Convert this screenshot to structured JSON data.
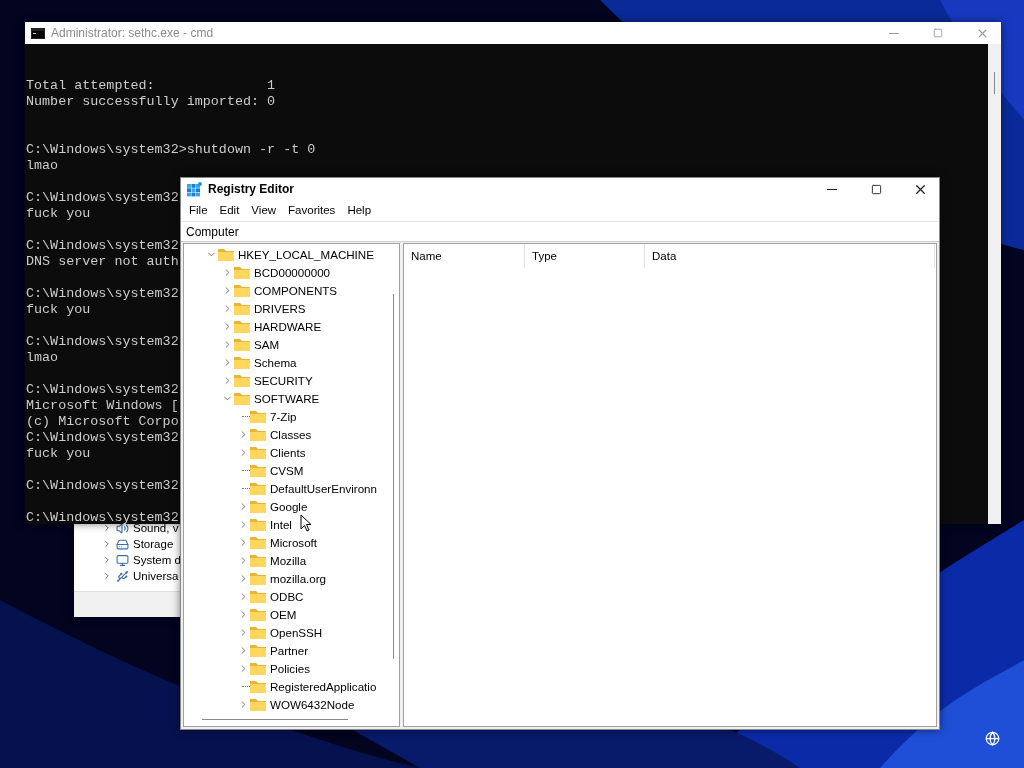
{
  "device_manager": {
    "items": [
      {
        "kind": "sound",
        "label": "Sound, v"
      },
      {
        "kind": "storage",
        "label": "Storage"
      },
      {
        "kind": "system",
        "label": "System d"
      },
      {
        "kind": "usb",
        "label": "Universa"
      }
    ]
  },
  "cmd": {
    "title": "Administrator: sethc.exe - cmd",
    "blocks": [
      [
        "Total attempted:              1",
        "Number successfully imported: 0"
      ],
      [
        "C:\\Windows\\system32>shutdown -r -t 0",
        "lmao"
      ],
      [
        "C:\\Windows\\system32",
        "fuck you"
      ],
      [
        "C:\\Windows\\system32",
        "DNS server not auth"
      ],
      [
        "C:\\Windows\\system32",
        "fuck you"
      ],
      [
        "C:\\Windows\\system32",
        "lmao"
      ],
      [
        "C:\\Windows\\system32",
        "Microsoft Windows [",
        "(c) Microsoft Corpo",
        "C:\\Windows\\system32",
        "fuck you"
      ],
      [
        "C:\\Windows\\system32"
      ],
      [
        "C:\\Windows\\system32"
      ]
    ]
  },
  "regedit": {
    "title": "Registry Editor",
    "menu": [
      "File",
      "Edit",
      "View",
      "Favorites",
      "Help"
    ],
    "address": "Computer",
    "tree": [
      {
        "label": "HKEY_LOCAL_MACHINE",
        "expanded": true,
        "children": [
          {
            "label": "BCD00000000",
            "expanded": false
          },
          {
            "label": "COMPONENTS",
            "expanded": false
          },
          {
            "label": "DRIVERS",
            "expanded": false
          },
          {
            "label": "HARDWARE",
            "expanded": false
          },
          {
            "label": "SAM",
            "expanded": false
          },
          {
            "label": "Schema",
            "expanded": false
          },
          {
            "label": "SECURITY",
            "expanded": false
          },
          {
            "label": "SOFTWARE",
            "expanded": true,
            "children": [
              {
                "label": "7-Zip"
              },
              {
                "label": "Classes",
                "expanded": false
              },
              {
                "label": "Clients",
                "expanded": false
              },
              {
                "label": "CVSM"
              },
              {
                "label": "DefaultUserEnvironn"
              },
              {
                "label": "Google",
                "expanded": false
              },
              {
                "label": "Intel",
                "expanded": false
              },
              {
                "label": "Microsoft",
                "expanded": false
              },
              {
                "label": "Mozilla",
                "expanded": false
              },
              {
                "label": "mozilla.org",
                "expanded": false
              },
              {
                "label": "ODBC",
                "expanded": false
              },
              {
                "label": "OEM",
                "expanded": false
              },
              {
                "label": "OpenSSH",
                "expanded": false
              },
              {
                "label": "Partner",
                "expanded": false
              },
              {
                "label": "Policies",
                "expanded": false
              },
              {
                "label": "RegisteredApplicatio"
              },
              {
                "label": "WOW6432Node",
                "expanded": false
              }
            ]
          }
        ]
      }
    ],
    "columns": [
      "Name",
      "Type",
      "Data"
    ]
  }
}
